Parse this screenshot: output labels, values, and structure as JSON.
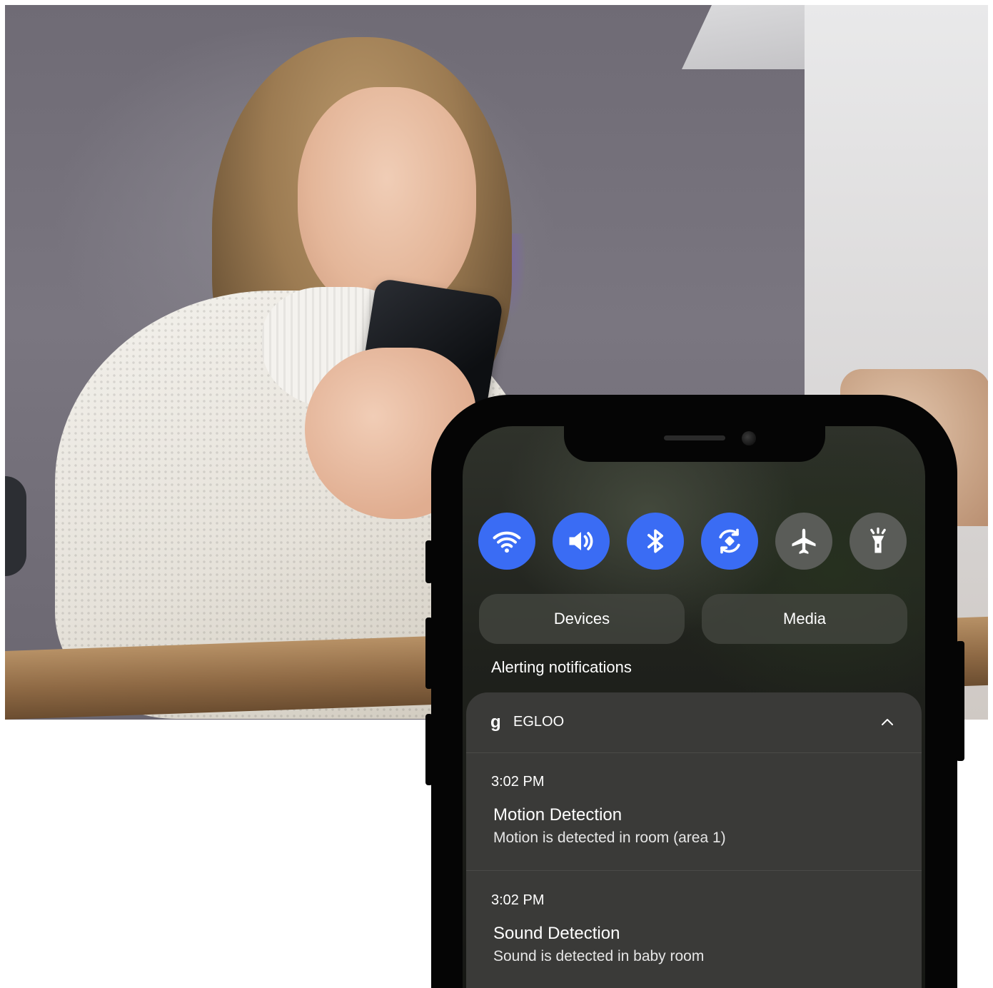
{
  "quick_settings": {
    "toggles": [
      {
        "icon": "wifi-icon",
        "state": "on"
      },
      {
        "icon": "volume-icon",
        "state": "on"
      },
      {
        "icon": "bluetooth-icon",
        "state": "on"
      },
      {
        "icon": "auto-rotate-icon",
        "state": "on"
      },
      {
        "icon": "airplane-icon",
        "state": "off"
      },
      {
        "icon": "flashlight-icon",
        "state": "off"
      }
    ],
    "devices_label": "Devices",
    "media_label": "Media"
  },
  "notifications": {
    "section_title": "Alerting notifications",
    "app": {
      "logo": "g",
      "name": "EGLOO"
    },
    "items": [
      {
        "time": "3:02 PM",
        "title": "Motion Detection",
        "body": "Motion is detected in room (area 1)"
      },
      {
        "time": "3:02 PM",
        "title": "Sound Detection",
        "body": "Sound is detected in baby room"
      }
    ]
  },
  "colors": {
    "toggle_on": "#3a6cf4",
    "toggle_off": "#5a5c58",
    "card_bg": "#3a3a38"
  }
}
